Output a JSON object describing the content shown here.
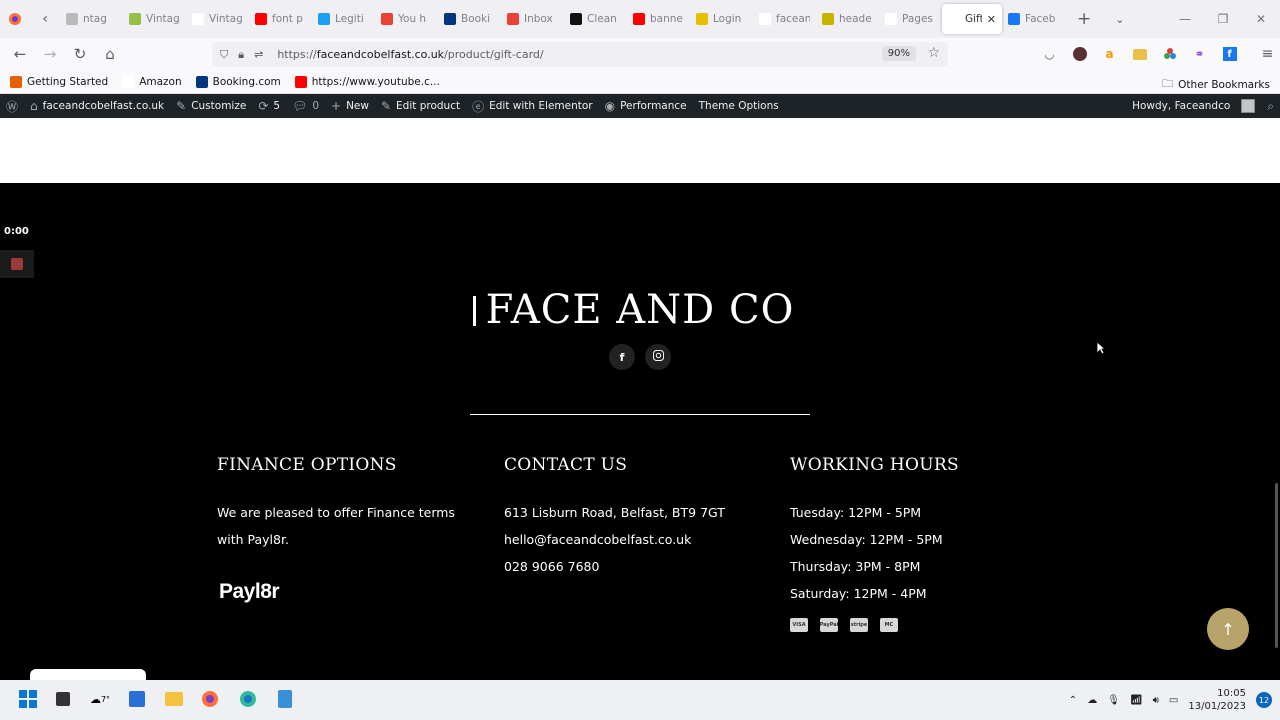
{
  "browser": {
    "tabs": [
      {
        "label": "ntag",
        "icon_color": "#b9b9b9"
      },
      {
        "label": "Vintag",
        "icon_color": "#95bf47"
      },
      {
        "label": "Vintage R",
        "icon_color": "#ffffff"
      },
      {
        "label": "font p",
        "icon_color": "#ff0000"
      },
      {
        "label": "Legiti",
        "icon_color": "#1ca1f2"
      },
      {
        "label": "You h",
        "icon_color": "#ea4335"
      },
      {
        "label": "Booki",
        "icon_color": "#003580"
      },
      {
        "label": "Inbox",
        "icon_color": "#ea4335"
      },
      {
        "label": "Clean",
        "icon_color": "#111111"
      },
      {
        "label": "banne",
        "icon_color": "#ff0000"
      },
      {
        "label": "Login",
        "icon_color": "#e6c000"
      },
      {
        "label": "faceandco",
        "icon_color": "#ffffff"
      },
      {
        "label": "heade",
        "icon_color": "#c8b400"
      },
      {
        "label": "Pages ‹ fa",
        "icon_color": "#ffffff"
      },
      {
        "label": "Gift Ca",
        "icon_color": "#ffffff",
        "active": true
      },
      {
        "label": "Faceb",
        "icon_color": "#1877f2"
      }
    ],
    "url_prefix": "https://",
    "url_domain": "faceandcobelfast.co.uk",
    "url_path": "/product/gift-card/",
    "zoom": "90%",
    "bookmarks": [
      {
        "label": "Getting Started",
        "icon_color": "#e66000"
      },
      {
        "label": "Amazon",
        "icon_color": "#ffffff"
      },
      {
        "label": "Booking.com",
        "icon_color": "#003580"
      },
      {
        "label": "https://www.youtube.c...",
        "icon_color": "#ff0000"
      }
    ],
    "other_bookmarks": "Other Bookmarks"
  },
  "wpbar": {
    "site": "faceandcobelfast.co.uk",
    "customize": "Customize",
    "updates": "5",
    "comments": "0",
    "new": "New",
    "edit_product": "Edit product",
    "elementor": "Edit with Elementor",
    "performance": "Performance",
    "theme_options": "Theme Options",
    "howdy": "Howdy, Faceandco"
  },
  "recorder": {
    "time": "0:00"
  },
  "footer": {
    "brand": "FACE AND CO",
    "finance": {
      "title": "FINANCE OPTIONS",
      "text": "We are pleased to offer Finance terms with Payl8r.",
      "logo": "Payl8r"
    },
    "contact": {
      "title": "CONTACT US",
      "address": "613 Lisburn Road, Belfast, BT9 7GT",
      "email": "hello@faceandcobelfast.co.uk",
      "phone": "028 9066 7680"
    },
    "hours": {
      "title": "WORKING HOURS",
      "lines": [
        "Tuesday: 12PM - 5PM",
        "Wednesday: 12PM - 5PM",
        "Thursday: 3PM - 8PM",
        "Saturday: 12PM - 4PM"
      ]
    },
    "payment_cards": [
      "VISA",
      "PayPal",
      "stripe",
      "MC"
    ]
  },
  "taskbar": {
    "weather": "7°",
    "time": "10:05",
    "date": "13/01/2023",
    "notifications": "12"
  }
}
